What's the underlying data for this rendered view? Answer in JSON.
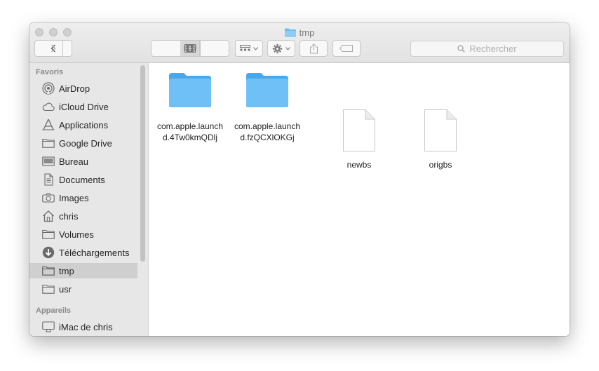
{
  "window": {
    "title": "tmp"
  },
  "toolbar": {
    "search_placeholder": "Rechercher"
  },
  "sidebar": {
    "favorites_header": "Favoris",
    "items": [
      {
        "label": "AirDrop"
      },
      {
        "label": "iCloud Drive"
      },
      {
        "label": "Applications"
      },
      {
        "label": "Google Drive"
      },
      {
        "label": "Bureau"
      },
      {
        "label": "Documents"
      },
      {
        "label": "Images"
      },
      {
        "label": "chris"
      },
      {
        "label": "Volumes"
      },
      {
        "label": "Téléchargements"
      },
      {
        "label": "tmp",
        "selected": true
      },
      {
        "label": "usr"
      }
    ],
    "devices_header": "Appareils",
    "devices": [
      {
        "label": "iMac de chris"
      }
    ]
  },
  "files": [
    {
      "name": "com.apple.launchd.4Tw0kmQDlj",
      "line1": "com.apple.launch",
      "line2": "d.4Tw0kmQDlj",
      "kind": "folder"
    },
    {
      "name": "com.apple.launchd.fzQCXlOKGj",
      "line1": "com.apple.launch",
      "line2": "d.fzQCXlOKGj",
      "kind": "folder"
    },
    {
      "name": "newbs",
      "line1": "newbs",
      "kind": "document"
    },
    {
      "name": "origbs",
      "line1": "origbs",
      "kind": "document"
    }
  ],
  "colors": {
    "folder": "#5cb6f2",
    "selection": "#cfcfcf",
    "sidebar": "#e7e7e8"
  }
}
